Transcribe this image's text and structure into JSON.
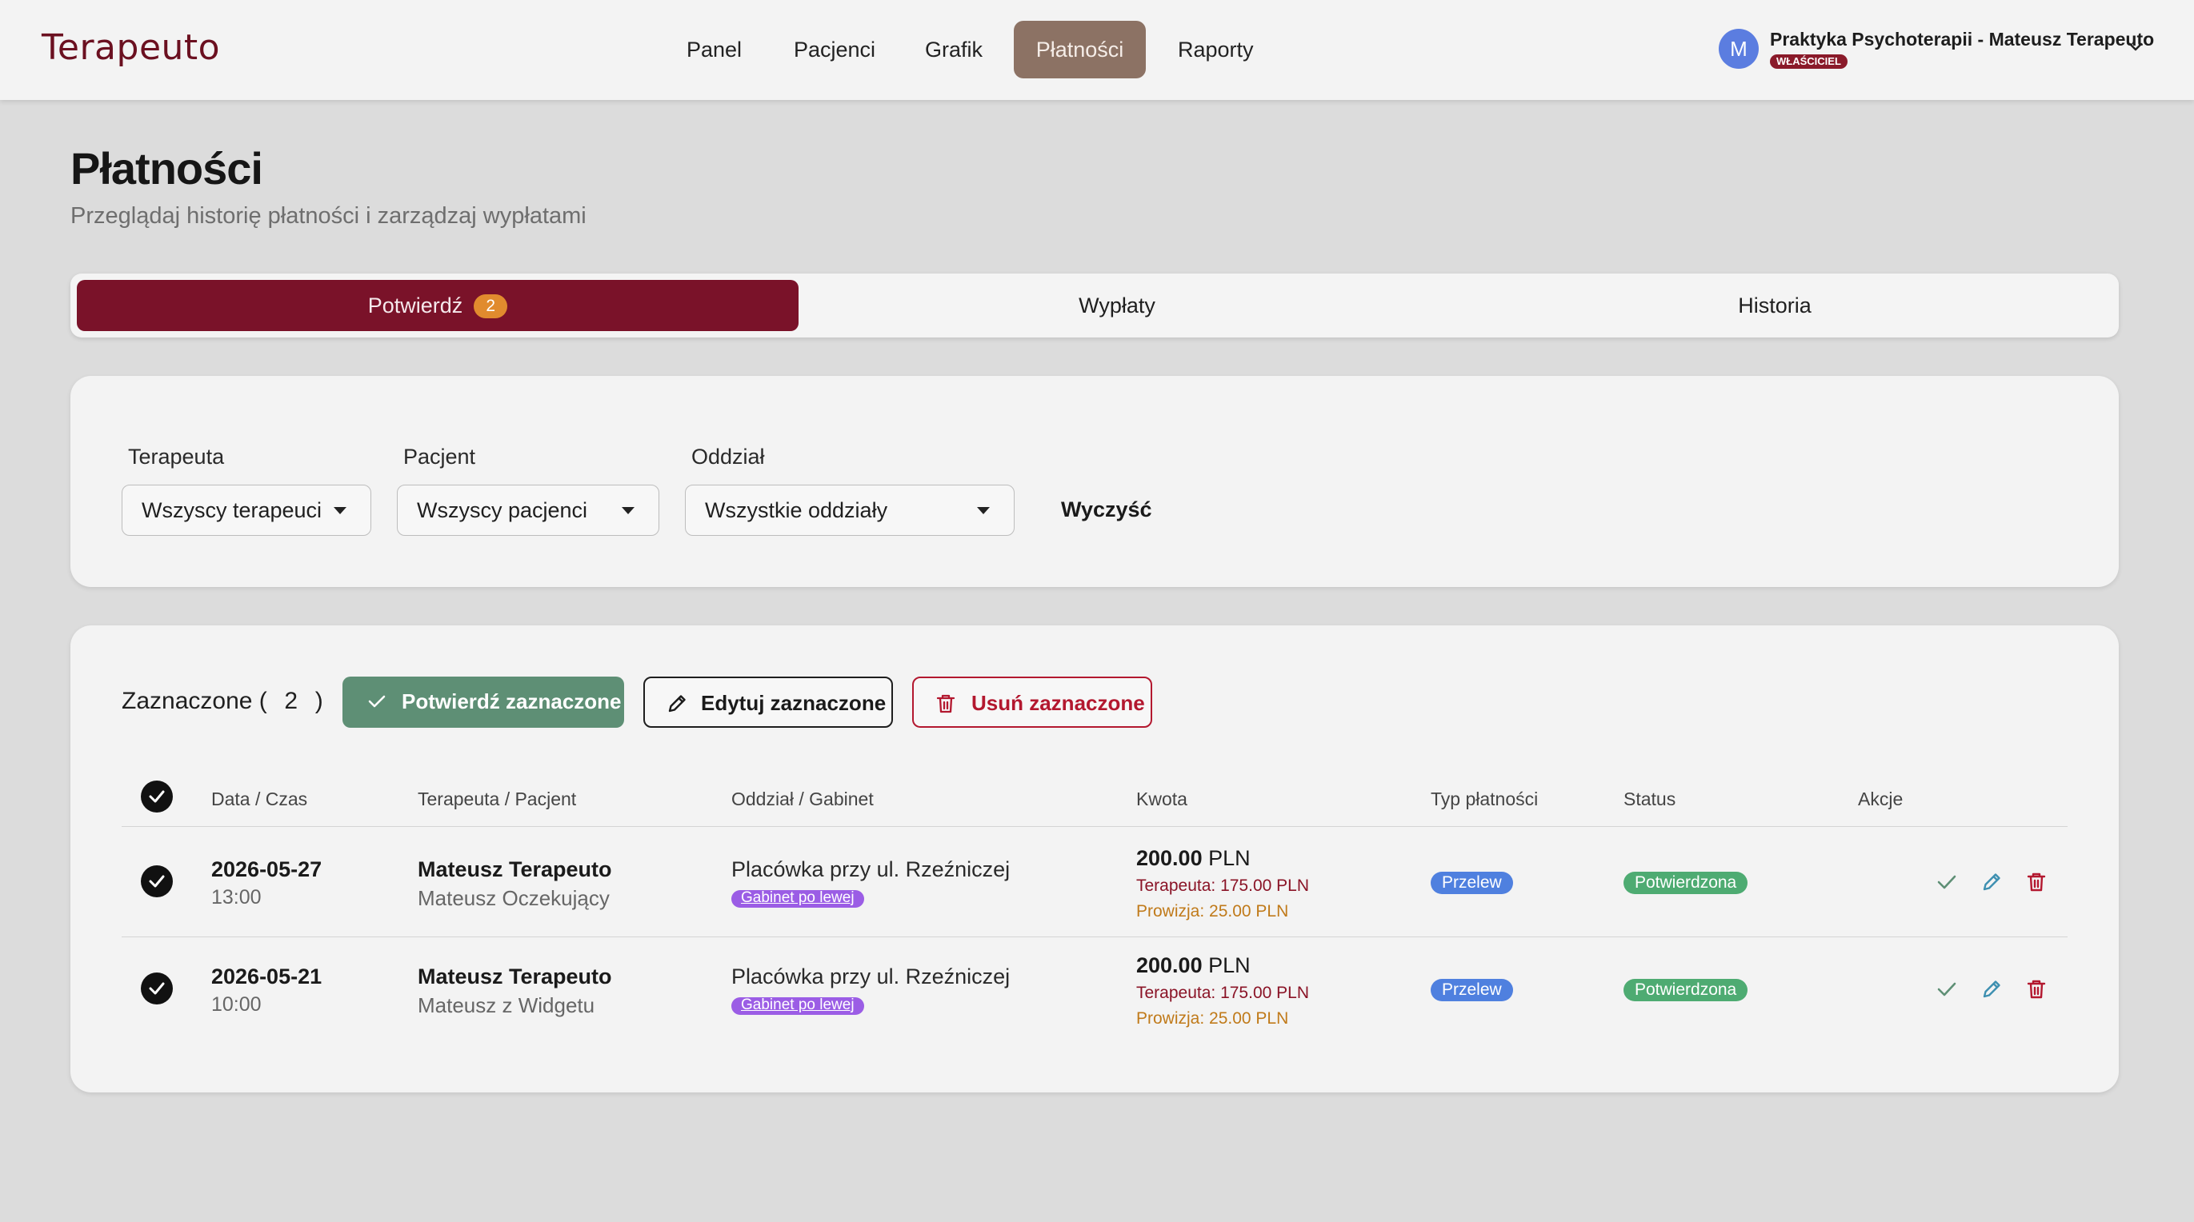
{
  "app": {
    "logo": "Terapeuto"
  },
  "nav": {
    "items": [
      {
        "label": "Panel",
        "active": false
      },
      {
        "label": "Pacjenci",
        "active": false
      },
      {
        "label": "Grafik",
        "active": false
      },
      {
        "label": "Płatności",
        "active": true
      },
      {
        "label": "Raporty",
        "active": false
      }
    ]
  },
  "user": {
    "avatar_initial": "M",
    "name": "Praktyka Psychoterapii - Mateusz Terapeuto",
    "role": "WŁAŚCICIEL"
  },
  "page": {
    "title": "Płatności",
    "subtitle": "Przeglądaj historię płatności i zarządzaj wypłatami"
  },
  "tabs": [
    {
      "label": "Potwierdź",
      "count": "2",
      "active": true
    },
    {
      "label": "Wypłaty",
      "active": false
    },
    {
      "label": "Historia",
      "active": false
    }
  ],
  "filters": {
    "therapist": {
      "label": "Terapeuta",
      "value": "Wszyscy terapeuci"
    },
    "patient": {
      "label": "Pacjent",
      "value": "Wszyscy pacjenci"
    },
    "branch": {
      "label": "Oddział",
      "value": "Wszystkie oddziały"
    },
    "clear_label": "Wyczyść"
  },
  "selection": {
    "label_prefix": "Zaznaczone (",
    "count": "2",
    "label_suffix": ")",
    "confirm_label": "Potwierdź zaznaczone",
    "edit_label": "Edytuj zaznaczone",
    "delete_label": "Usuń zaznaczone"
  },
  "table": {
    "columns": [
      "Data / Czas",
      "Terapeuta / Pacjent",
      "Oddział / Gabinet",
      "Kwota",
      "Typ płatności",
      "Status",
      "Akcje"
    ],
    "rows": [
      {
        "date": "2026-05-27",
        "time": "13:00",
        "therapist": "Mateusz Terapeuto",
        "patient": "Mateusz Oczekujący",
        "branch": "Placówka przy ul. Rzeźniczej",
        "room": "Gabinet po lewej",
        "amount_value": "200.00",
        "amount_currency": "PLN",
        "therapist_share": "Terapeuta: 175.00 PLN",
        "commission": "Prowizja: 25.00 PLN",
        "payment_type": "Przelew",
        "status": "Potwierdzona",
        "checked": true
      },
      {
        "date": "2026-05-21",
        "time": "10:00",
        "therapist": "Mateusz Terapeuto",
        "patient": "Mateusz z Widgetu",
        "branch": "Placówka przy ul. Rzeźniczej",
        "room": "Gabinet po lewej",
        "amount_value": "200.00",
        "amount_currency": "PLN",
        "therapist_share": "Terapeuta: 175.00 PLN",
        "commission": "Prowizja: 25.00 PLN",
        "payment_type": "Przelew",
        "status": "Potwierdzona",
        "checked": true
      }
    ]
  },
  "colors": {
    "brand": "#7a1229",
    "nav_active": "#8c7264",
    "confirm": "#5e8f75",
    "danger": "#b3182f",
    "room_badge": "#9b5de5",
    "pill_blue": "#4f80df",
    "pill_green": "#4eab72",
    "count_badge": "#e18b2e"
  }
}
